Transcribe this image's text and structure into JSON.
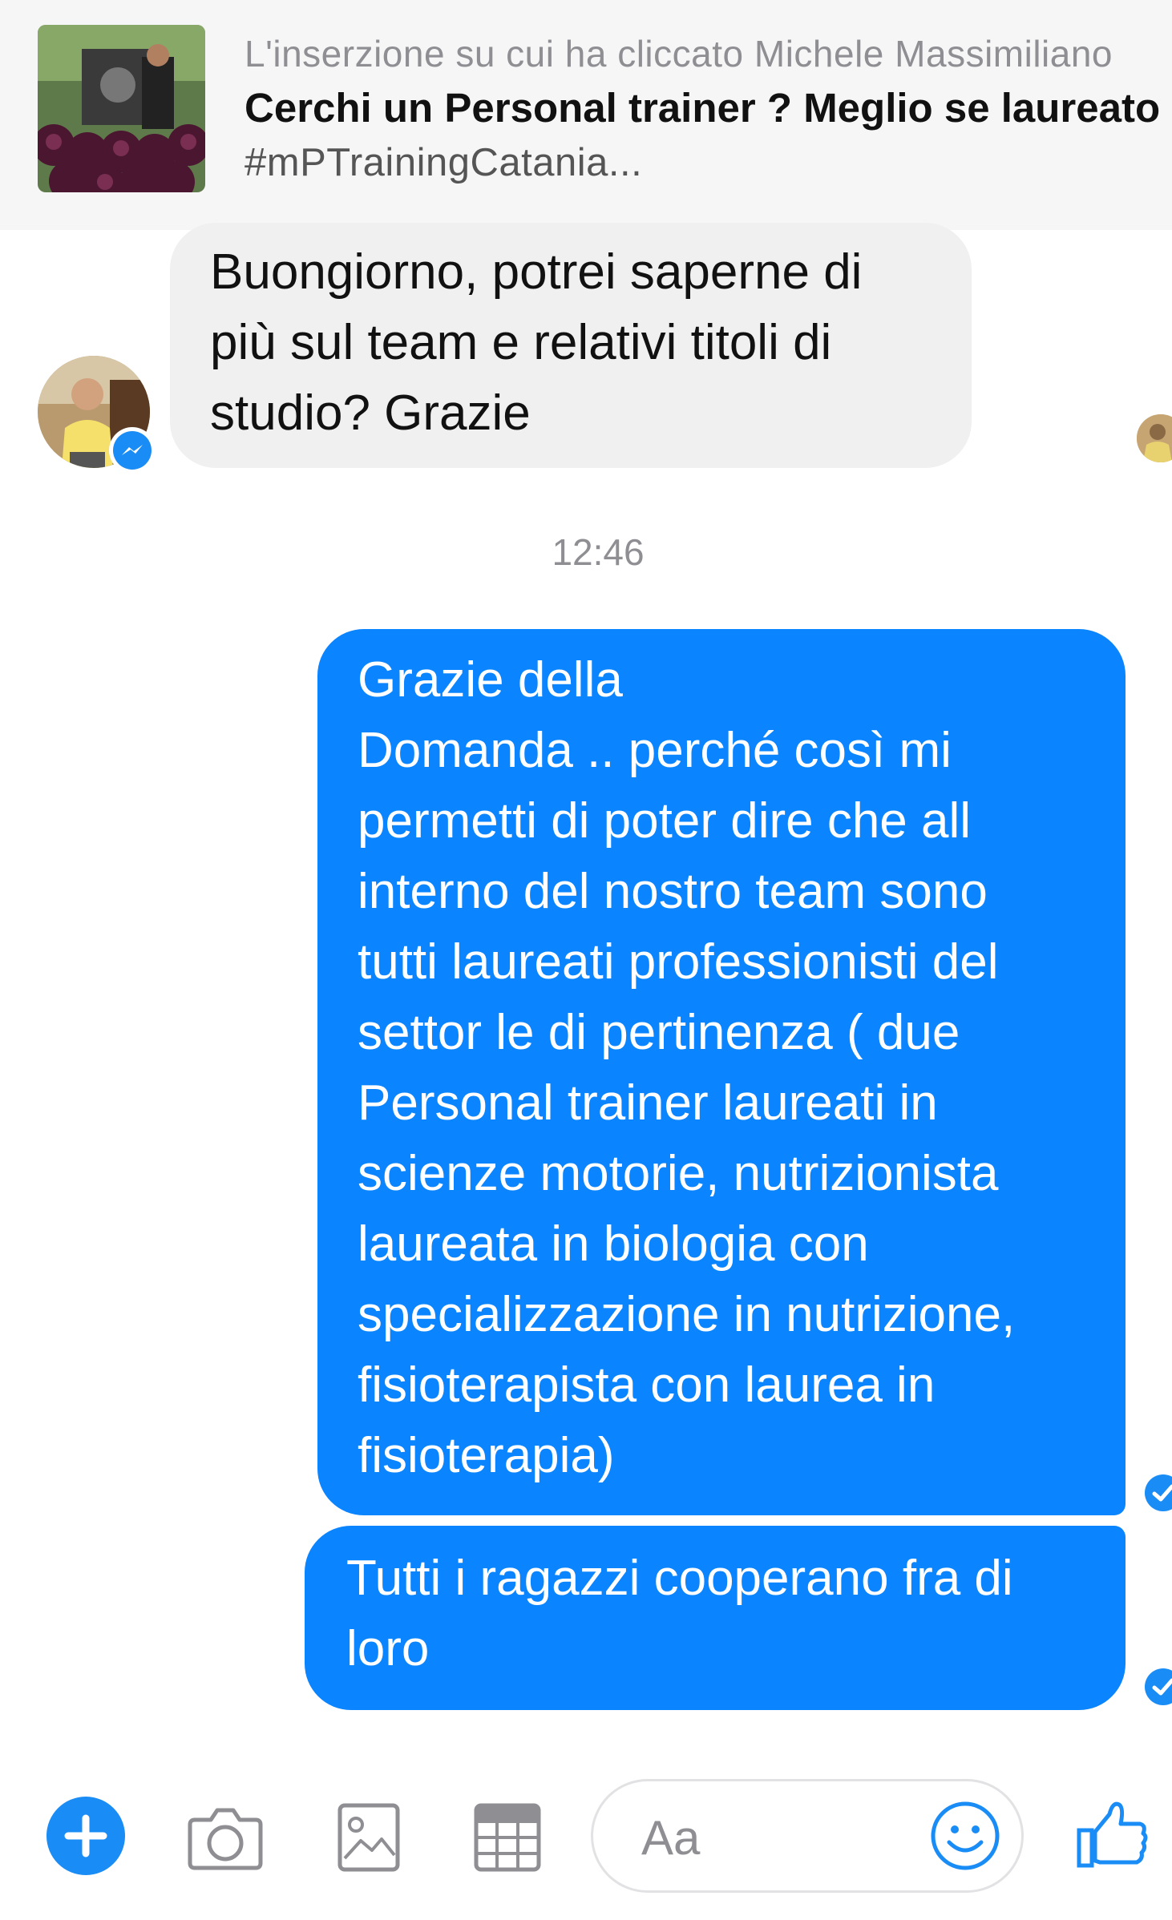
{
  "ad": {
    "source": "L'inserzione su cui ha cliccato Michele Massimiliano",
    "title": "Cerchi un Personal trainer ? Meglio se laureato",
    "tag": "#mPTrainingCatania..."
  },
  "conversation": {
    "incoming": [
      {
        "lines": [
          "Buongiorno, potrei saperne di",
          "più sul team e relativi titoli di",
          "studio? Grazie"
        ]
      }
    ],
    "timestamp": "12:46",
    "outgoing": [
      {
        "lines": [
          "Grazie della",
          "Domanda .. perché così mi",
          "permetti di poter dire che all",
          "interno del nostro team sono",
          "tutti laureati professionisti del",
          "settor le di pertinenza ( due",
          "Personal trainer laureati in",
          "scienze motorie, nutrizionista",
          "laureata in biologia con",
          "specializzazione in nutrizione,",
          "fisioterapista con laurea in",
          "fisioterapia)"
        ]
      },
      {
        "lines": [
          "Tutti i ragazzi cooperano fra di",
          "loro"
        ]
      }
    ]
  },
  "composer": {
    "placeholder": "Aa",
    "icons": [
      "plus-icon",
      "camera-icon",
      "image-icon",
      "gif-sticker-icon",
      "emoji-icon",
      "thumbs-up-icon"
    ]
  },
  "colors": {
    "accent": "#0a84ff",
    "incoming_bubble": "#f0f0f0",
    "header_bg": "#f6f6f7"
  }
}
